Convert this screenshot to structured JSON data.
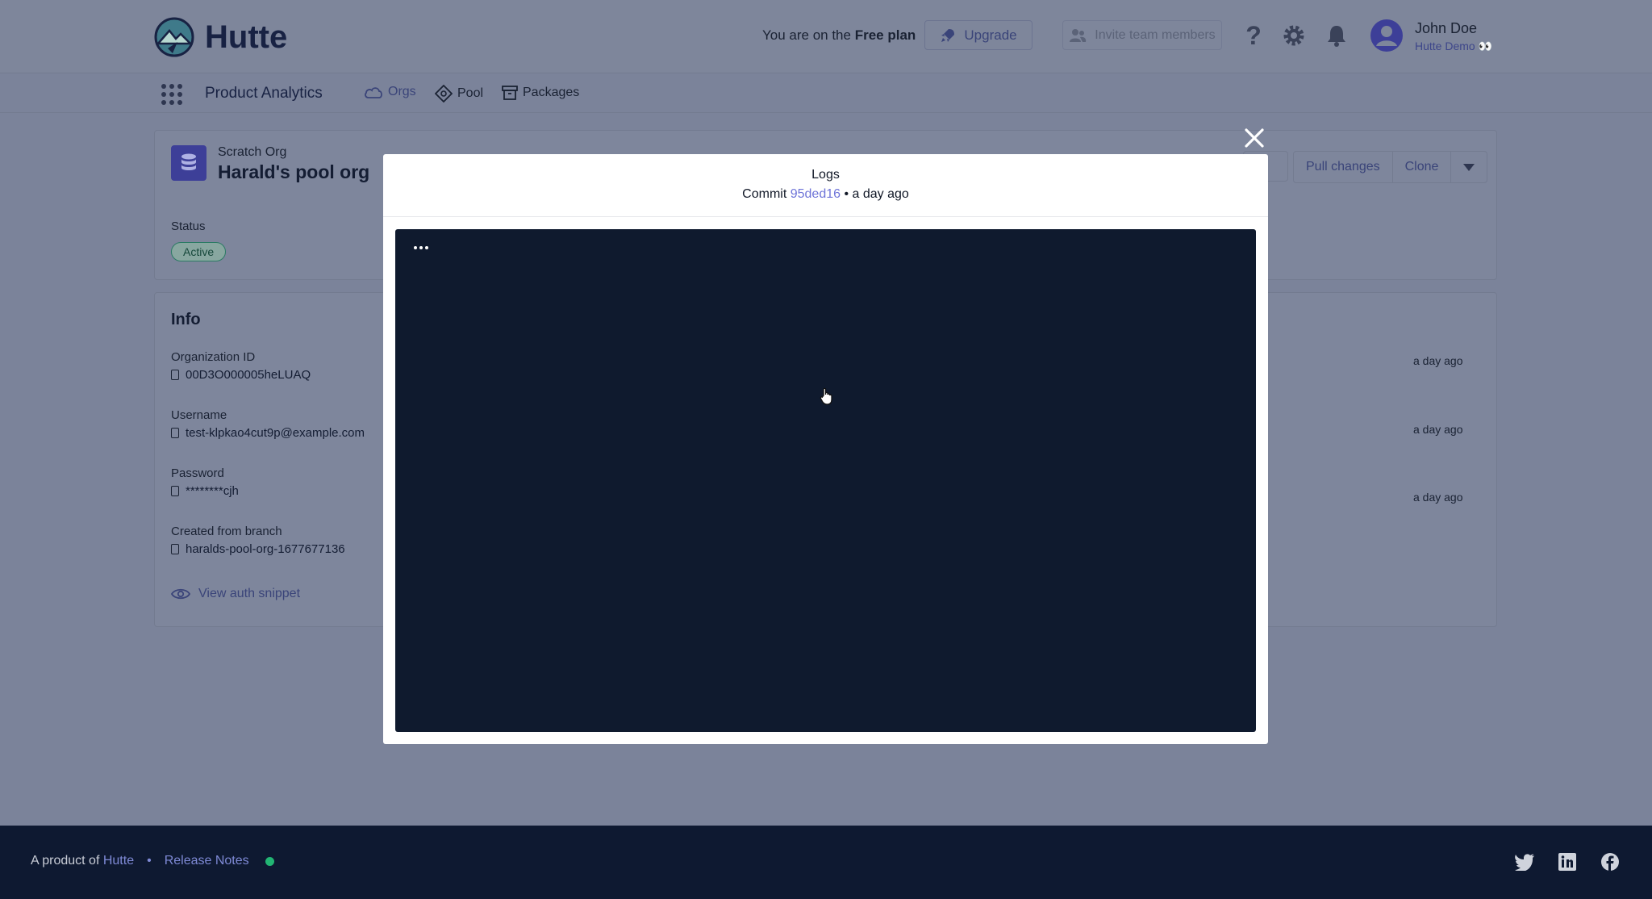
{
  "header": {
    "brand": "Hutte",
    "plan_prefix": "You are on the",
    "plan_name": "Free plan",
    "upgrade_label": "Upgrade",
    "invite_label": "Invite team members",
    "user_name": "John Doe",
    "user_org": "Hutte Demo 👀"
  },
  "nav": {
    "app_name": "Product Analytics",
    "items": [
      {
        "label": "Orgs",
        "icon": "cloud-icon",
        "active": true
      },
      {
        "label": "Pool",
        "icon": "pool-icon",
        "active": false
      },
      {
        "label": "Packages",
        "icon": "package-icon",
        "active": false
      }
    ]
  },
  "org": {
    "kind": "Scratch Org",
    "title": "Harald's pool org",
    "status_label": "Status",
    "status": "Active",
    "actions": [
      "Pull changes",
      "Clone"
    ]
  },
  "info": {
    "title": "Info",
    "fields": [
      {
        "label": "Organization ID",
        "value": "00D3O000005heLUAQ"
      },
      {
        "label": "Username",
        "value": "test-klpkao4cut9p@example.com"
      },
      {
        "label": "Password",
        "value": "********cjh"
      },
      {
        "label": "Created from branch",
        "value": "haralds-pool-org-1677677136"
      }
    ],
    "auth_link": "View auth snippet",
    "timestamps": [
      "a day ago",
      "a day ago",
      "a day ago"
    ]
  },
  "modal": {
    "title": "Logs",
    "commit_prefix": "Commit",
    "commit_hash": "95ded16",
    "commit_time": "• a day ago"
  },
  "footer": {
    "product_prefix": "A product of",
    "product_link": "Hutte",
    "separator": "•",
    "release_notes": "Release Notes"
  },
  "colors": {
    "accent": "#6f75d8",
    "log_background": "#0f1a2e",
    "footer_background": "#0e1931",
    "status_ok": "#22b573"
  }
}
